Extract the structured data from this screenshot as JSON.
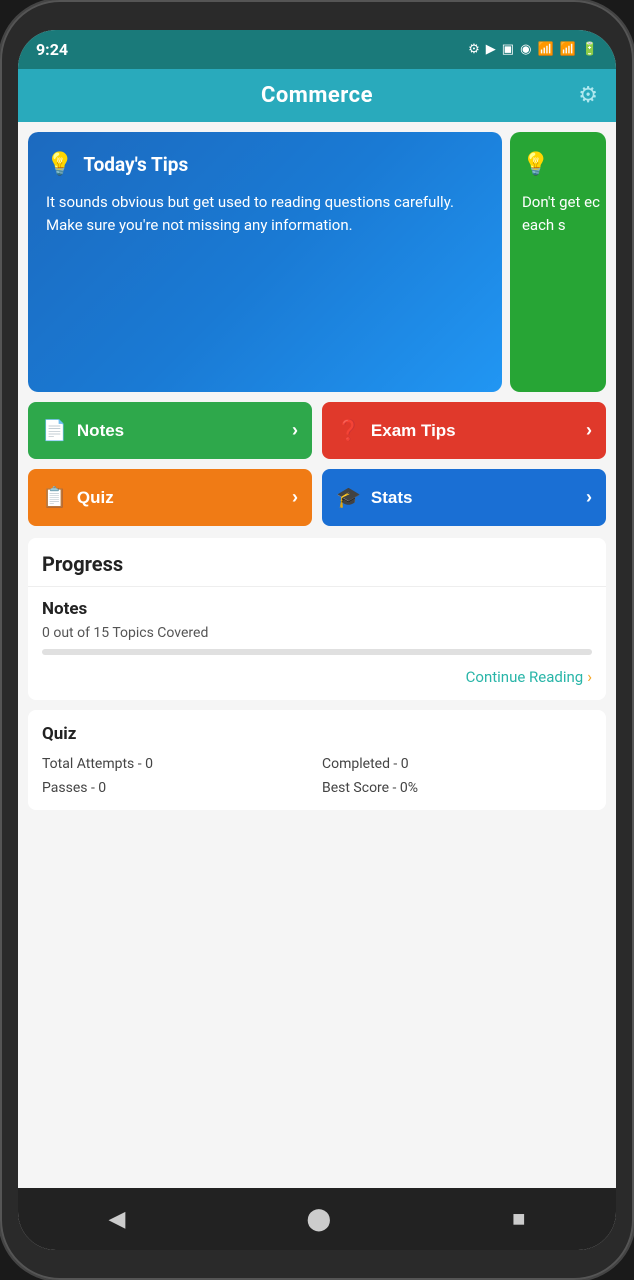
{
  "statusBar": {
    "time": "9:24",
    "icons": [
      "⚙",
      "▶",
      "☰",
      "◉"
    ]
  },
  "header": {
    "title": "Commerce",
    "gearIcon": "⚙"
  },
  "tipCards": [
    {
      "id": "blue",
      "icon": "💡",
      "title": "Today's Tips",
      "text": "It sounds obvious but get used to reading questions carefully. Make sure you're not missing any information."
    },
    {
      "id": "green",
      "icon": "💡",
      "text": "Don't get ec each s"
    }
  ],
  "actionButtons": [
    {
      "id": "notes",
      "label": "Notes",
      "icon": "📄",
      "colorClass": "btn-notes"
    },
    {
      "id": "exam",
      "label": "Exam Tips",
      "icon": "❓",
      "colorClass": "btn-exam"
    },
    {
      "id": "quiz",
      "label": "Quiz",
      "icon": "📋",
      "colorClass": "btn-quiz"
    },
    {
      "id": "stats",
      "label": "Stats",
      "icon": "🎓",
      "colorClass": "btn-stats"
    }
  ],
  "progress": {
    "sectionTitle": "Progress",
    "notesCard": {
      "title": "Notes",
      "subtitle": "0 out of 15 Topics Covered",
      "barFill": 0,
      "continueLabel": "Continue Reading"
    },
    "quizCard": {
      "title": "Quiz",
      "stats": [
        {
          "label": "Total Attempts - 0",
          "col": 1
        },
        {
          "label": "Completed - 0",
          "col": 2
        },
        {
          "label": "Passes - 0",
          "col": 1
        },
        {
          "label": "Best Score - 0%",
          "col": 2
        }
      ]
    }
  },
  "navBar": {
    "back": "◀",
    "home": "⬤",
    "square": "■"
  }
}
